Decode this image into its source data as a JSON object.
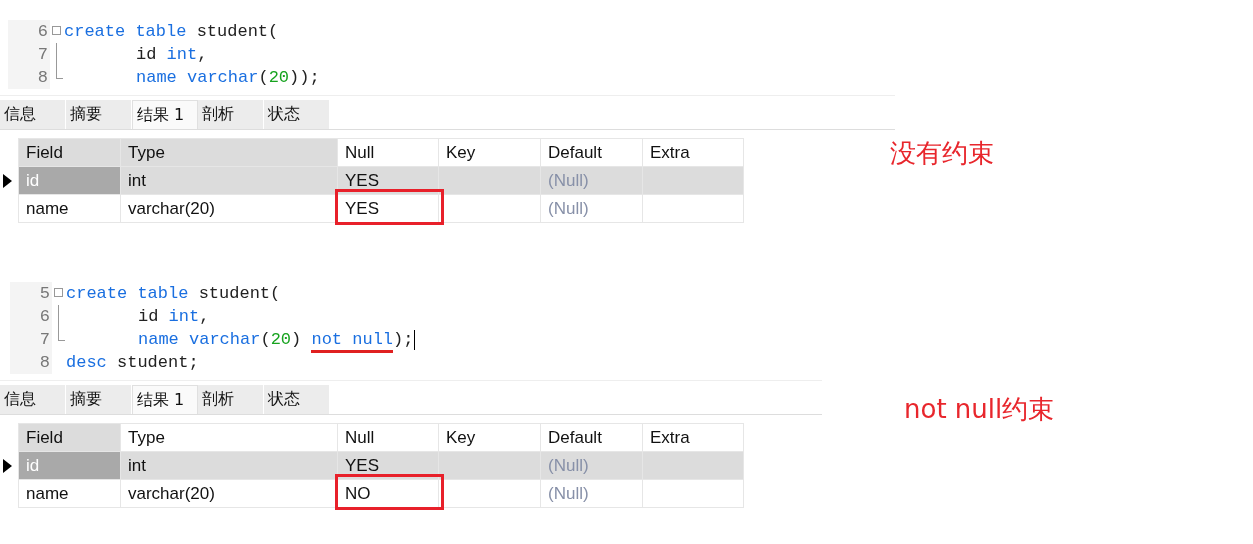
{
  "panels": [
    {
      "code_lines": [
        {
          "number": "6",
          "fold_toggle": true,
          "fold_guide": false,
          "indented": false,
          "tokens": [
            {
              "text": "create",
              "kind": "keyword"
            },
            {
              "text": " table",
              "kind": "keyword"
            },
            {
              "text": " student(",
              "kind": "plain"
            }
          ]
        },
        {
          "number": "7",
          "fold_toggle": false,
          "fold_guide": true,
          "block_end": false,
          "indented": true,
          "tokens": [
            {
              "text": "id",
              "kind": "plain"
            },
            {
              "text": " int",
              "kind": "keyword"
            },
            {
              "text": ",",
              "kind": "plain"
            }
          ]
        },
        {
          "number": "8",
          "fold_toggle": false,
          "fold_guide": true,
          "block_end": true,
          "indented": true,
          "tokens": [
            {
              "text": "name",
              "kind": "keyword"
            },
            {
              "text": " varchar",
              "kind": "keyword"
            },
            {
              "text": "(",
              "kind": "plain"
            },
            {
              "text": "20",
              "kind": "number"
            },
            {
              "text": "));",
              "kind": "plain"
            }
          ]
        }
      ],
      "tabs": [
        {
          "label": "信息",
          "selected": false
        },
        {
          "label": "摘要",
          "selected": false
        },
        {
          "label": "结果 1",
          "selected": true
        },
        {
          "label": "剖析",
          "selected": false
        },
        {
          "label": "状态",
          "selected": false
        }
      ],
      "table": {
        "columns": [
          {
            "label": "Field",
            "shaded": true
          },
          {
            "label": "Type",
            "shaded": true
          },
          {
            "label": "Null",
            "shaded": false
          },
          {
            "label": "Key",
            "shaded": false
          },
          {
            "label": "Default",
            "shaded": false
          },
          {
            "label": "Extra",
            "shaded": false
          }
        ],
        "rows": [
          {
            "selected": true,
            "cells": [
              {
                "text": "id",
                "kind": "value",
                "current": true,
                "highlighted": false
              },
              {
                "text": "int",
                "kind": "value",
                "current": false,
                "highlighted": false
              },
              {
                "text": "YES",
                "kind": "value",
                "current": false,
                "highlighted": false
              },
              {
                "text": "",
                "kind": "value",
                "current": false,
                "highlighted": false
              },
              {
                "text": "(Null)",
                "kind": "null",
                "current": false,
                "highlighted": false
              },
              {
                "text": "",
                "kind": "value",
                "current": false,
                "highlighted": false
              }
            ]
          },
          {
            "selected": false,
            "cells": [
              {
                "text": "name",
                "kind": "value",
                "current": false,
                "highlighted": false
              },
              {
                "text": "varchar(20)",
                "kind": "value",
                "current": false,
                "highlighted": false
              },
              {
                "text": "YES",
                "kind": "value",
                "current": false,
                "highlighted": true
              },
              {
                "text": "",
                "kind": "value",
                "current": false,
                "highlighted": false
              },
              {
                "text": "(Null)",
                "kind": "null",
                "current": false,
                "highlighted": false
              },
              {
                "text": "",
                "kind": "value",
                "current": false,
                "highlighted": false
              }
            ]
          }
        ]
      },
      "note": "没有约束"
    },
    {
      "code_lines": [
        {
          "number": "5",
          "fold_toggle": true,
          "fold_guide": false,
          "indented": false,
          "tokens": [
            {
              "text": "create",
              "kind": "keyword"
            },
            {
              "text": " table",
              "kind": "keyword"
            },
            {
              "text": " student(",
              "kind": "plain"
            }
          ]
        },
        {
          "number": "6",
          "fold_toggle": false,
          "fold_guide": true,
          "block_end": false,
          "indented": true,
          "tokens": [
            {
              "text": "id",
              "kind": "plain"
            },
            {
              "text": " int",
              "kind": "keyword"
            },
            {
              "text": ",",
              "kind": "plain"
            }
          ]
        },
        {
          "number": "7",
          "fold_toggle": false,
          "fold_guide": true,
          "block_end": true,
          "indented": true,
          "tokens": [
            {
              "text": "name",
              "kind": "keyword"
            },
            {
              "text": " varchar",
              "kind": "keyword"
            },
            {
              "text": "(",
              "kind": "plain"
            },
            {
              "text": "20",
              "kind": "number"
            },
            {
              "text": ") ",
              "kind": "plain"
            },
            {
              "text": "not null",
              "kind": "keyword",
              "underlined": true
            },
            {
              "text": ");",
              "kind": "plain"
            }
          ],
          "cursor": true
        },
        {
          "number": "8",
          "fold_toggle": false,
          "fold_guide": false,
          "indented": false,
          "tokens": [
            {
              "text": "desc",
              "kind": "keyword"
            },
            {
              "text": " student;",
              "kind": "plain"
            }
          ]
        }
      ],
      "tabs": [
        {
          "label": "信息",
          "selected": false
        },
        {
          "label": "摘要",
          "selected": false
        },
        {
          "label": "结果 1",
          "selected": true
        },
        {
          "label": "剖析",
          "selected": false
        },
        {
          "label": "状态",
          "selected": false
        }
      ],
      "table": {
        "columns": [
          {
            "label": "Field",
            "shaded": true
          },
          {
            "label": "Type",
            "shaded": false
          },
          {
            "label": "Null",
            "shaded": false
          },
          {
            "label": "Key",
            "shaded": false
          },
          {
            "label": "Default",
            "shaded": false
          },
          {
            "label": "Extra",
            "shaded": false
          }
        ],
        "rows": [
          {
            "selected": true,
            "cells": [
              {
                "text": "id",
                "kind": "value",
                "current": true,
                "highlighted": false
              },
              {
                "text": "int",
                "kind": "value",
                "current": false,
                "highlighted": false
              },
              {
                "text": "YES",
                "kind": "value",
                "current": false,
                "highlighted": false
              },
              {
                "text": "",
                "kind": "value",
                "current": false,
                "highlighted": false
              },
              {
                "text": "(Null)",
                "kind": "null",
                "current": false,
                "highlighted": false
              },
              {
                "text": "",
                "kind": "value",
                "current": false,
                "highlighted": false
              }
            ]
          },
          {
            "selected": false,
            "cells": [
              {
                "text": "name",
                "kind": "value",
                "current": false,
                "highlighted": false
              },
              {
                "text": "varchar(20)",
                "kind": "value",
                "current": false,
                "highlighted": false
              },
              {
                "text": "NO",
                "kind": "value",
                "current": false,
                "highlighted": true
              },
              {
                "text": "",
                "kind": "value",
                "current": false,
                "highlighted": false
              },
              {
                "text": "(Null)",
                "kind": "null",
                "current": false,
                "highlighted": false
              },
              {
                "text": "",
                "kind": "value",
                "current": false,
                "highlighted": false
              }
            ]
          }
        ]
      },
      "note": "not null约束"
    }
  ]
}
